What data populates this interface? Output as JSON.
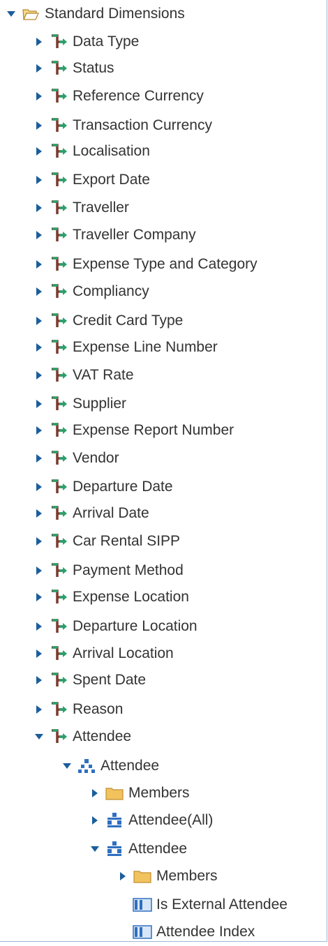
{
  "root": {
    "label": "Standard Dimensions",
    "icon": "open-folder-icon"
  },
  "dimensions": [
    "Data Type",
    "Status",
    "Reference Currency",
    "Transaction Currency",
    "Localisation",
    "Export Date",
    "Traveller",
    "Traveller Company",
    "Expense Type and Category",
    "Compliancy",
    "Credit Card Type",
    "Expense Line Number",
    "VAT Rate",
    "Supplier",
    "Expense Report Number",
    "Vendor",
    "Departure Date",
    "Arrival Date",
    "Car Rental SIPP",
    "Payment Method",
    "Expense Location",
    "Departure Location",
    "Arrival Location",
    "Spent Date",
    "Reason"
  ],
  "attendee_dimension": {
    "label": "Attendee",
    "hierarchy": {
      "label": "Attendee",
      "members_label": "Members",
      "all_level": {
        "label": "Attendee(All)"
      },
      "level": {
        "label": "Attendee",
        "members_label": "Members",
        "attributes": [
          "Is External Attendee",
          "Attendee Index"
        ]
      }
    }
  },
  "colors": {
    "twisty": "#1b5e9c",
    "dimension_green": "#2aa06a",
    "dimension_brown": "#7a3b2e",
    "hierarchy_blue": "#2f6fc0",
    "folder": "#f2c25e"
  }
}
